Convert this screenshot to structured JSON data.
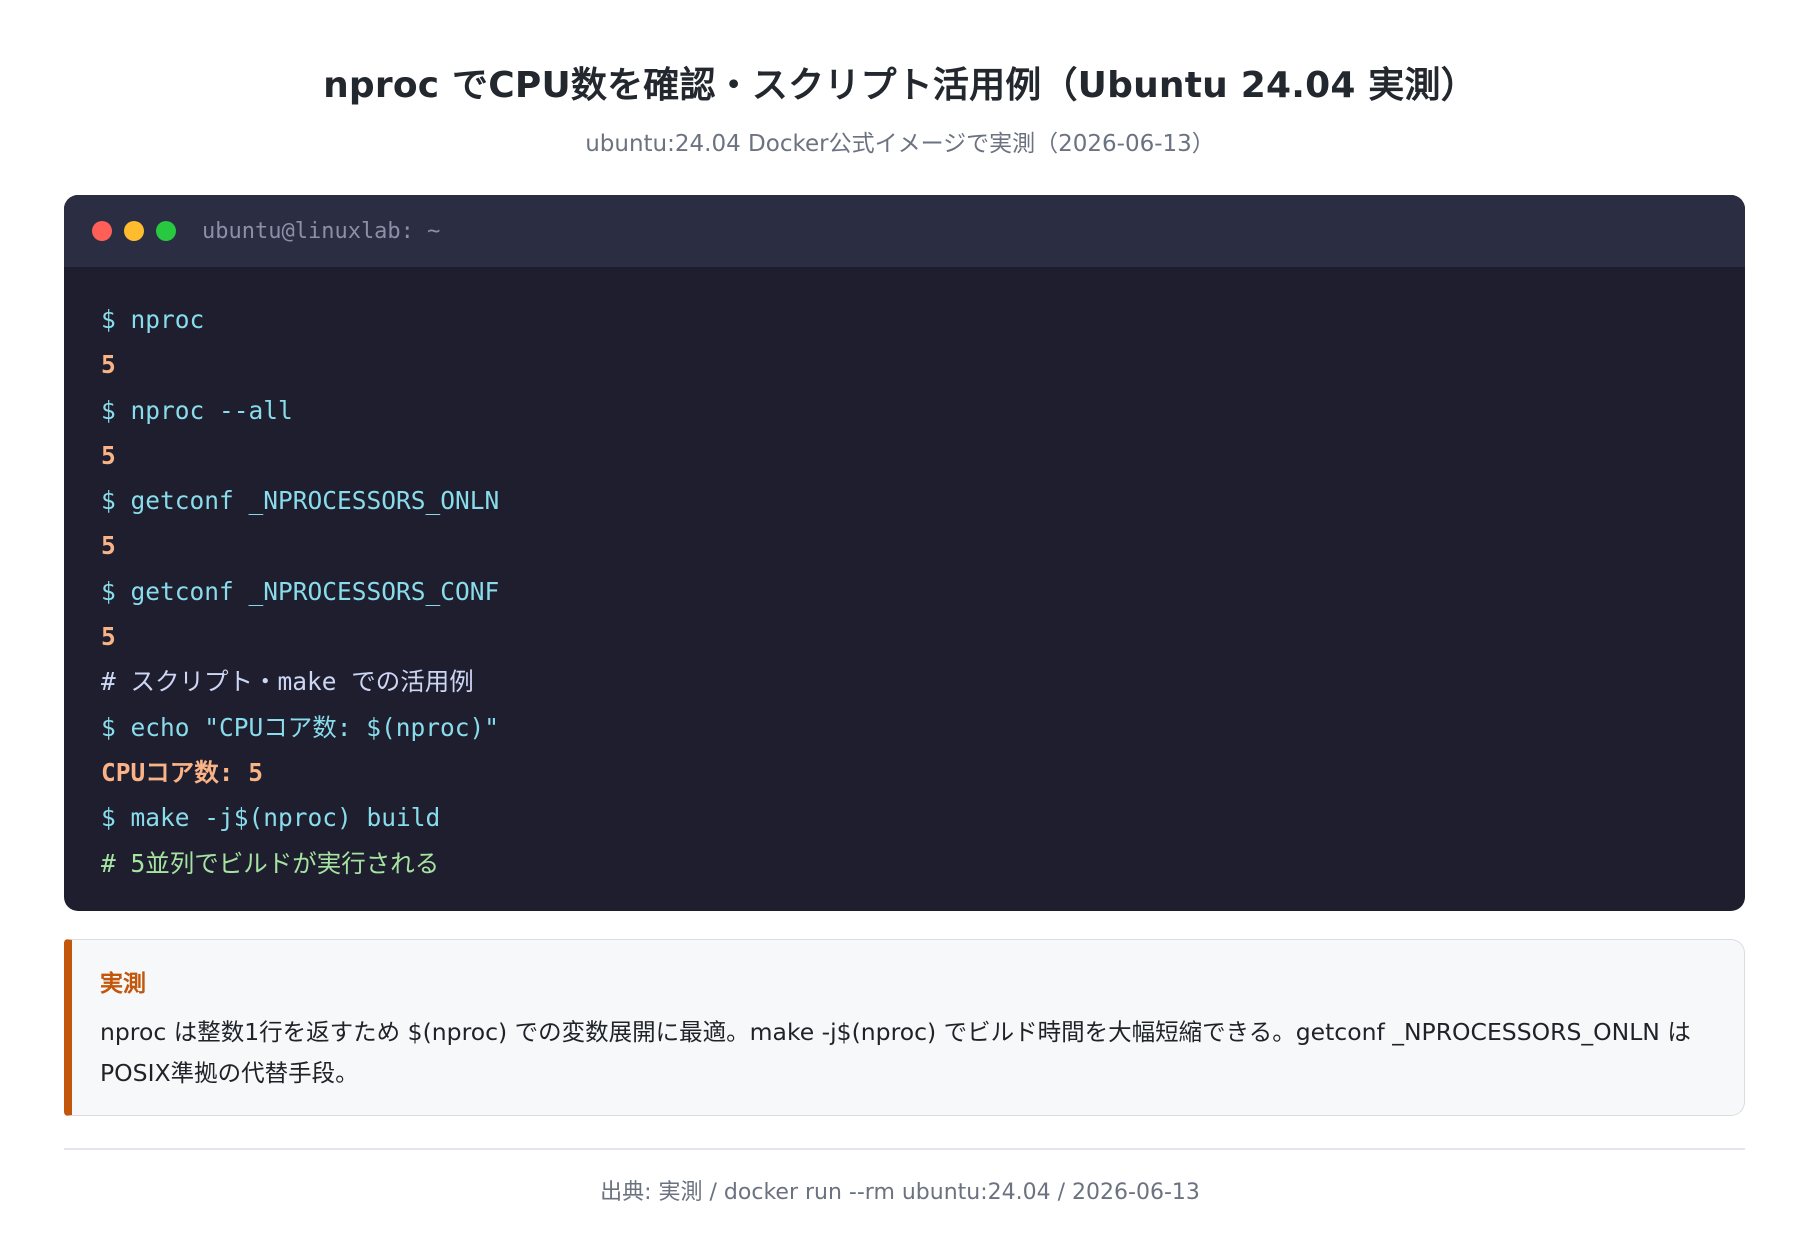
{
  "header": {
    "title": "nproc でCPU数を確認・スクリプト活用例（Ubuntu 24.04 実測）",
    "subtitle": "ubuntu:24.04 Docker公式イメージで実測（2026-06-13）"
  },
  "terminal": {
    "title": "ubuntu@linuxlab: ~",
    "lines": [
      {
        "type": "cmd",
        "text": "$ nproc"
      },
      {
        "type": "out",
        "text": "5"
      },
      {
        "type": "cmd",
        "text": "$ nproc --all"
      },
      {
        "type": "out",
        "text": "5"
      },
      {
        "type": "cmd",
        "text": "$ getconf _NPROCESSORS_ONLN"
      },
      {
        "type": "out",
        "text": "5"
      },
      {
        "type": "cmd",
        "text": "$ getconf _NPROCESSORS_CONF"
      },
      {
        "type": "out",
        "text": "5"
      },
      {
        "type": "cmt",
        "text": "# スクリプト・make での活用例"
      },
      {
        "type": "cmd",
        "text": "$ echo \"CPUコア数: $(nproc)\""
      },
      {
        "type": "out",
        "text": "CPUコア数: 5"
      },
      {
        "type": "cmd",
        "text": "$ make -j$(nproc) build"
      },
      {
        "type": "cmt-green",
        "text": "# 5並列でビルドが実行される"
      }
    ]
  },
  "note": {
    "label": "実測",
    "text": "nproc は整数1行を返すため $(nproc) での変数展開に最適。make -j$(nproc) でビルド時間を大幅短縮できる。getconf _NPROCESSORS_ONLN は POSIX準拠の代替手段。"
  },
  "footer": {
    "text": "出典: 実測 / docker run --rm ubuntu:24.04 / 2026-06-13"
  },
  "colors": {
    "terminal_bg": "#1e1e2e",
    "titlebar_bg": "#2b2d42",
    "command": "#89dceb",
    "output": "#fab387",
    "comment_green": "#a6e3a1",
    "accent": "#c2570c"
  }
}
